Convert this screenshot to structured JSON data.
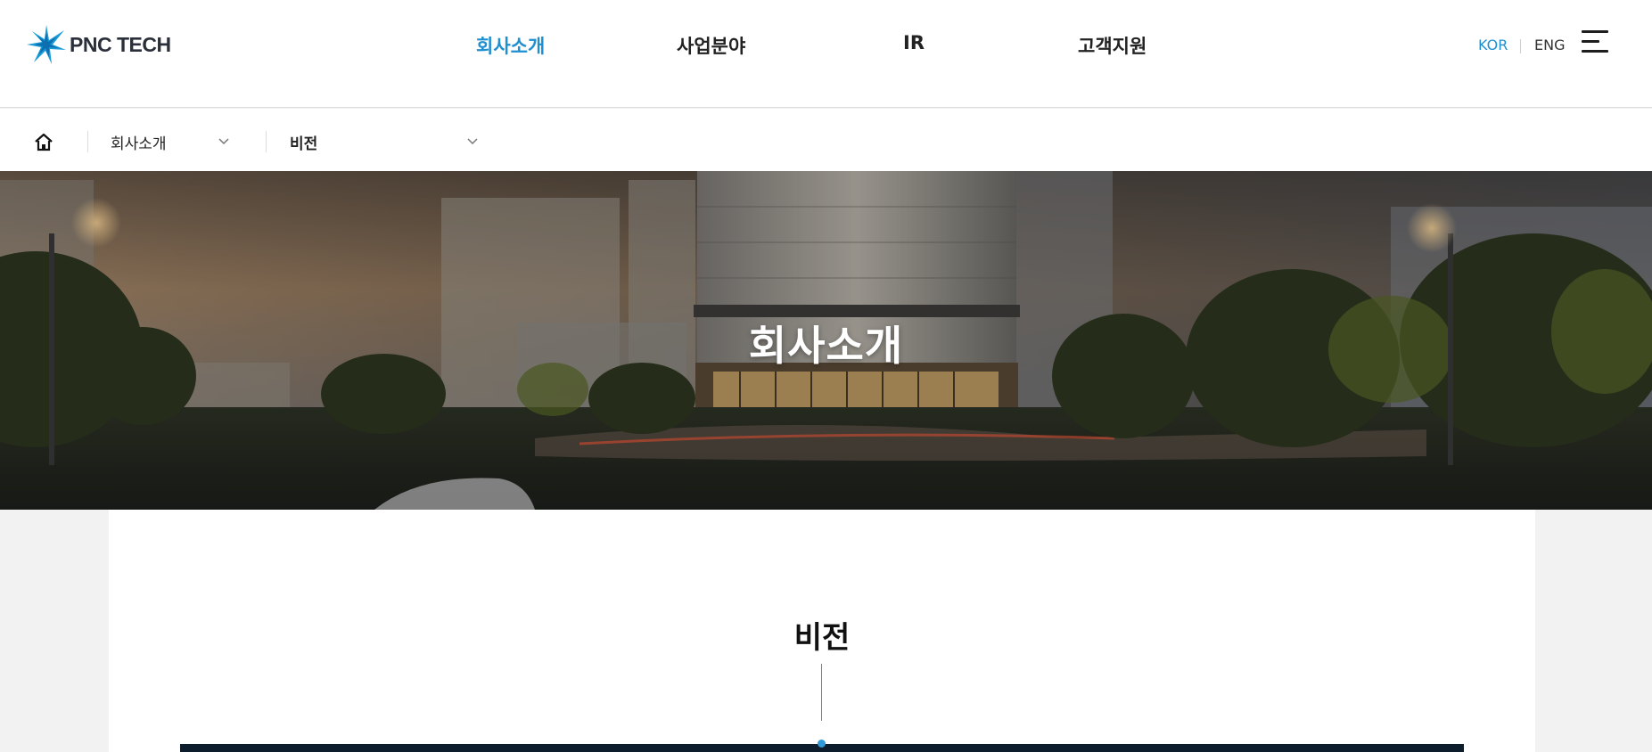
{
  "header": {
    "logo_text": "PNC TECH",
    "nav": [
      {
        "label": "회사소개",
        "active": true
      },
      {
        "label": "사업분야",
        "active": false
      },
      {
        "label": "IR",
        "active": false
      },
      {
        "label": "고객지원",
        "active": false
      }
    ],
    "lang_kor": "KOR",
    "lang_eng": "ENG",
    "menu_icon": "hamburger-menu-icon"
  },
  "location": {
    "home_icon": "home-icon",
    "depth1": "회사소개",
    "depth2": "비전",
    "chevron_icon": "chevron-down-icon"
  },
  "hero": {
    "title": "회사소개"
  },
  "content": {
    "title": "비전"
  },
  "colors": {
    "accent": "#1f8fd0",
    "text": "#222222",
    "page_bg": "#f2f2f2",
    "banner_dark": "#0e1d2c"
  }
}
